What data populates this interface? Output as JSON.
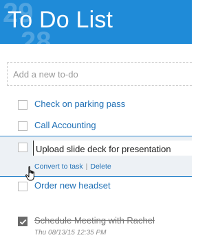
{
  "header": {
    "title": "To Do List",
    "background_color": "#1f8bd8",
    "decoration_numbers": [
      "29",
      "28"
    ]
  },
  "add_todo": {
    "placeholder": "Add a new to-do",
    "value": ""
  },
  "tasks": [
    {
      "label": "Check on parking pass",
      "completed": false
    },
    {
      "label": "Call Accounting",
      "completed": false
    },
    {
      "label": "Upload slide deck for presentation",
      "completed": false,
      "editing": true,
      "actions": {
        "convert_label": "Convert to task",
        "separator": "|",
        "delete_label": "Delete"
      }
    },
    {
      "label": "Order new headset",
      "completed": false
    },
    {
      "label": "Schedule Meeting with Rachel",
      "completed": true,
      "timestamp": "Thu 08/13/15 12:35 PM"
    }
  ],
  "colors": {
    "accent": "#1f8bd8",
    "task_text": "#1e6fb5",
    "completed_text": "#777777",
    "selected_bg": "#edf1f5"
  },
  "cursor": {
    "type": "hand-pointer"
  }
}
